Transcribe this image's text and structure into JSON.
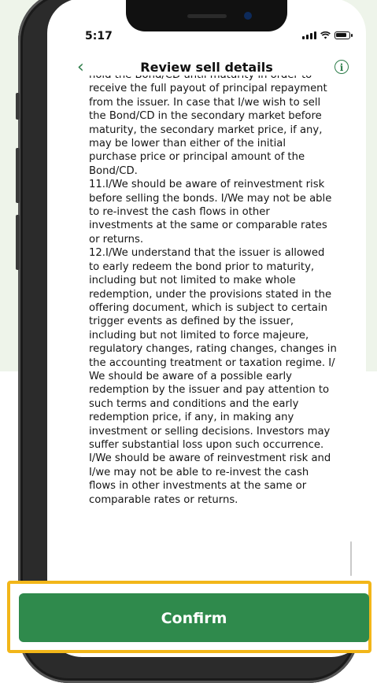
{
  "status_bar": {
    "time": "5:17"
  },
  "header": {
    "title": "Review sell details"
  },
  "terms_text": "hold the Bond/CD until maturity in order to\nreceive the full payout of principal repayment\nfrom the issuer. In case that I/we wish to sell\nthe Bond/CD in the secondary market before\nmaturity, the secondary market price, if any,\nmay be lower than either of the initial\npurchase price or principal amount of the\nBond/CD.\n11.I/We should be aware of reinvestment risk\nbefore selling the bonds. I/We may not be able\nto re-invest the cash flows in other\ninvestments at the same or comparable rates\nor returns.\n12.I/We understand that the issuer is allowed\nto early redeem the bond prior to maturity,\nincluding but not limited to make whole\nredemption, under the provisions stated in the\noffering document, which is subject to certain\ntrigger events as defined by the issuer,\nincluding but not limited to force majeure,\nregulatory changes, rating changes, changes in\nthe accounting treatment or taxation regime. I/\nWe should be aware of a possible early\nredemption by the issuer and pay attention to\nsuch terms and conditions and the early\nredemption price, if any, in making any\ninvestment or selling decisions. Investors may\nsuffer substantial loss upon such occurrence.\nI/We should be aware of reinvestment risk and\nI/we may not be able to re-invest the cash\nflows in other investments at the same or\ncomparable rates or returns.",
  "confirm_label": "Confirm",
  "icons": {
    "back": "chevron-left-icon",
    "info": "info-icon"
  },
  "colors": {
    "accent_green": "#2f8a4c",
    "highlight_border": "#f2b619",
    "background_tint": "#eef4ea"
  }
}
